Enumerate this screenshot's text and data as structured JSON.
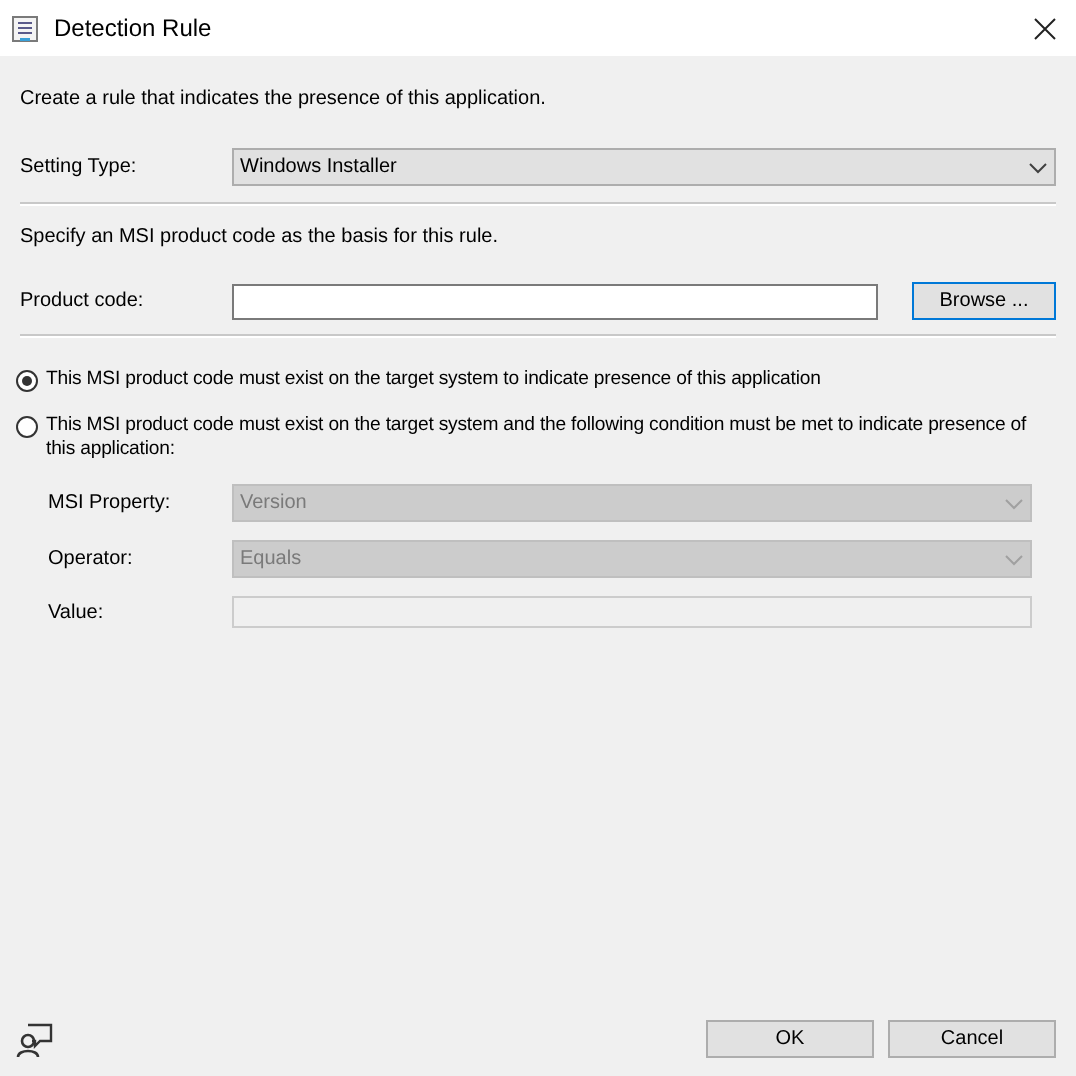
{
  "window": {
    "title": "Detection Rule"
  },
  "intro": "Create a rule that indicates the presence of this application.",
  "setting_type": {
    "label": "Setting Type:",
    "value": "Windows Installer"
  },
  "instruction": "Specify an MSI product code as the basis for this rule.",
  "product_code": {
    "label": "Product code:",
    "button": "Browse ..."
  },
  "options": [
    {
      "label": "This MSI product code must exist on the target system to indicate presence of this application",
      "selected": true
    },
    {
      "label": "This MSI product code must exist on the target system and the following condition must be met to indicate presence of this application:",
      "selected": false
    }
  ],
  "condition": [
    {
      "kind": "dropdown",
      "label": "MSI Property:",
      "value": "Version",
      "disabled": true
    },
    {
      "kind": "dropdown",
      "label": "Operator:",
      "value": "Equals",
      "disabled": true
    },
    {
      "kind": "text",
      "label": "Value:",
      "disabled": true
    }
  ],
  "buttons": [
    "OK",
    "Cancel"
  ]
}
